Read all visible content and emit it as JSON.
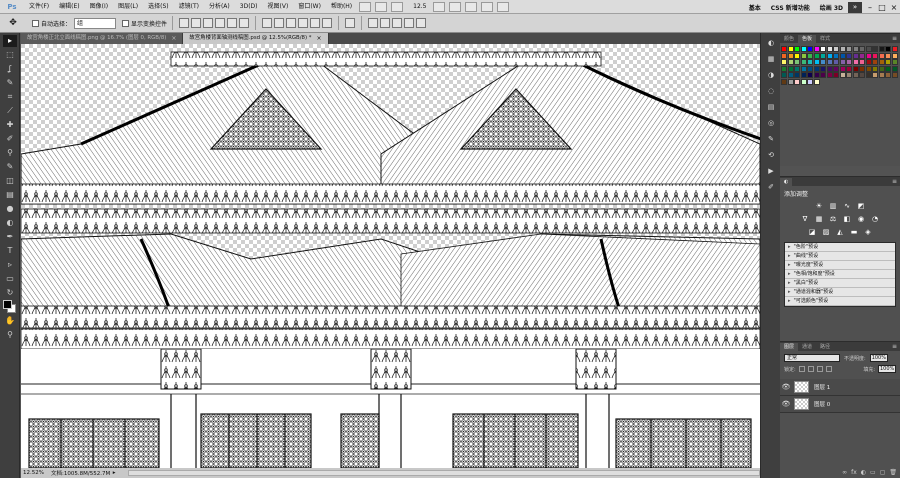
{
  "app": {
    "logo": "Ps",
    "menus": [
      "文件(F)",
      "编辑(E)",
      "图像(I)",
      "图层(L)",
      "选择(S)",
      "滤镜(T)",
      "分析(A)",
      "3D(D)",
      "视图(V)",
      "窗口(W)",
      "帮助(H)"
    ],
    "zoom_readout": "12.5",
    "workspaces": [
      "基本",
      "CSS 新增功能",
      "绘画 3D"
    ],
    "more": "»",
    "window_buttons": [
      "–",
      "□",
      "×"
    ]
  },
  "options": {
    "tool_icon": "move-tool-icon",
    "auto_select_label": "自动选择：",
    "auto_select_value": "组",
    "show_transform_label": "显示变换控件"
  },
  "tools": [
    {
      "name": "move-tool",
      "glyph": "▸"
    },
    {
      "name": "marquee-tool",
      "glyph": "⬚"
    },
    {
      "name": "lasso-tool",
      "glyph": "ʆ"
    },
    {
      "name": "quick-select-tool",
      "glyph": "✎"
    },
    {
      "name": "crop-tool",
      "glyph": "⌗"
    },
    {
      "name": "eyedropper-tool",
      "glyph": "⟋"
    },
    {
      "name": "healing-tool",
      "glyph": "✚"
    },
    {
      "name": "brush-tool",
      "glyph": "✐"
    },
    {
      "name": "clone-stamp-tool",
      "glyph": "⚲"
    },
    {
      "name": "history-brush-tool",
      "glyph": "✎"
    },
    {
      "name": "eraser-tool",
      "glyph": "◫"
    },
    {
      "name": "gradient-tool",
      "glyph": "▤"
    },
    {
      "name": "blur-tool",
      "glyph": "●"
    },
    {
      "name": "dodge-tool",
      "glyph": "◐"
    },
    {
      "name": "pen-tool",
      "glyph": "✒"
    },
    {
      "name": "type-tool",
      "glyph": "T"
    },
    {
      "name": "path-select-tool",
      "glyph": "▹"
    },
    {
      "name": "shape-tool",
      "glyph": "▭"
    },
    {
      "name": "3d-rotate-tool",
      "glyph": "↻"
    },
    {
      "name": "3d-orbit-tool",
      "glyph": "⊕"
    },
    {
      "name": "hand-tool",
      "glyph": "✋"
    },
    {
      "name": "zoom-tool",
      "glyph": "⚲"
    }
  ],
  "document": {
    "tabs": [
      {
        "title": "故宫角楼正北立面线稿图.png @ 16.7% (图层 0, RGB/8)",
        "active": false
      },
      {
        "title": "故宫角楼背面轴测线稿图.psd @ 12.5%(RGB/8) *",
        "active": true
      }
    ],
    "close_glyph": "×",
    "status_zoom": "12.52%",
    "status_doc": "文档:1005.8M/552.7M"
  },
  "dock_icons": [
    "color-panel-icon",
    "swatches-panel-icon",
    "adjustments-panel-icon",
    "masks-panel-icon",
    "layers-panel-icon",
    "channels-panel-icon",
    "paths-panel-icon",
    "history-panel-icon",
    "actions-panel-icon",
    "brush-panel-icon"
  ],
  "swatches_panel": {
    "tabs": [
      "颜色",
      "色板",
      "样式"
    ],
    "active_tab": 1,
    "colors": [
      "#ff0000",
      "#ffff00",
      "#00ff00",
      "#00ffff",
      "#0000ff",
      "#ff00ff",
      "#ffffff",
      "#e6e6e6",
      "#cccccc",
      "#b3b3b3",
      "#999999",
      "#808080",
      "#666666",
      "#4d4d4d",
      "#333333",
      "#1a1a1a",
      "#000000",
      "#ed1c24",
      "#f26522",
      "#f7941d",
      "#fff200",
      "#8dc63f",
      "#39b54a",
      "#00a651",
      "#00a99d",
      "#00aeef",
      "#0072bc",
      "#0054a6",
      "#2e3192",
      "#662d91",
      "#92278f",
      "#ec008c",
      "#ed145b",
      "#f26c4f",
      "#f68e56",
      "#fbaf5d",
      "#fff568",
      "#acd373",
      "#7cc576",
      "#3cb878",
      "#1cbbb4",
      "#00bff3",
      "#448ccb",
      "#5674b9",
      "#605ca8",
      "#8560a8",
      "#a864a8",
      "#f06eaa",
      "#f06292",
      "#9e0b0f",
      "#a0410d",
      "#a36209",
      "#aba000",
      "#598527",
      "#1a7b30",
      "#007236",
      "#00746b",
      "#0076a3",
      "#004b80",
      "#003471",
      "#1b1464",
      "#440e62",
      "#630460",
      "#9e005d",
      "#9e0039",
      "#790000",
      "#7b2e00",
      "#7d4900",
      "#827b00",
      "#406618",
      "#005e20",
      "#005826",
      "#005952",
      "#005b7f",
      "#003663",
      "#002157",
      "#0d004c",
      "#32004b",
      "#4b0049",
      "#7b0046",
      "#7a0026",
      "#c7b299",
      "#998675",
      "#736357",
      "#534741",
      "#37302a",
      "#c69c6d",
      "#a67c52",
      "#8c6239",
      "#754c24",
      "#603913",
      "#a0a0a0",
      "#ffcccc",
      "#ccffcc",
      "#ccccff",
      "#ffffcc"
    ]
  },
  "adjustments_panel": {
    "title": "添加调整",
    "row1_icons": [
      "brightness-icon",
      "levels-icon",
      "curves-icon",
      "exposure-icon"
    ],
    "row2_icons": [
      "vibrance-icon",
      "hue-saturation-icon",
      "color-balance-icon",
      "black-white-icon",
      "photo-filter-icon",
      "channel-mixer-icon"
    ],
    "row3_icons": [
      "invert-icon",
      "posterize-icon",
      "threshold-icon",
      "gradient-map-icon",
      "selective-color-icon"
    ],
    "presets": [
      "\"色阶\"预设",
      "\"曲线\"预设",
      "\"曝光度\"预设",
      "\"色相/饱和度\"预设",
      "\"黑白\"预设",
      "\"通道混和器\"预设",
      "\"可选颜色\"预设"
    ],
    "footer_icons": [
      "⌥",
      "⚙"
    ]
  },
  "layers_panel": {
    "tabs": [
      "图层",
      "通道",
      "路径"
    ],
    "active_tab": 0,
    "blend_mode": "正常",
    "opacity_label": "不透明度:",
    "opacity": "100%",
    "lock_label": "锁定:",
    "fill_label": "填充:",
    "fill": "100%",
    "layers": [
      {
        "name": "图层 1",
        "visible": true
      },
      {
        "name": "图层 0",
        "visible": true
      }
    ],
    "footer_icons": [
      "∞",
      "fx",
      "◐",
      "▭",
      "▢",
      "🗑"
    ]
  }
}
